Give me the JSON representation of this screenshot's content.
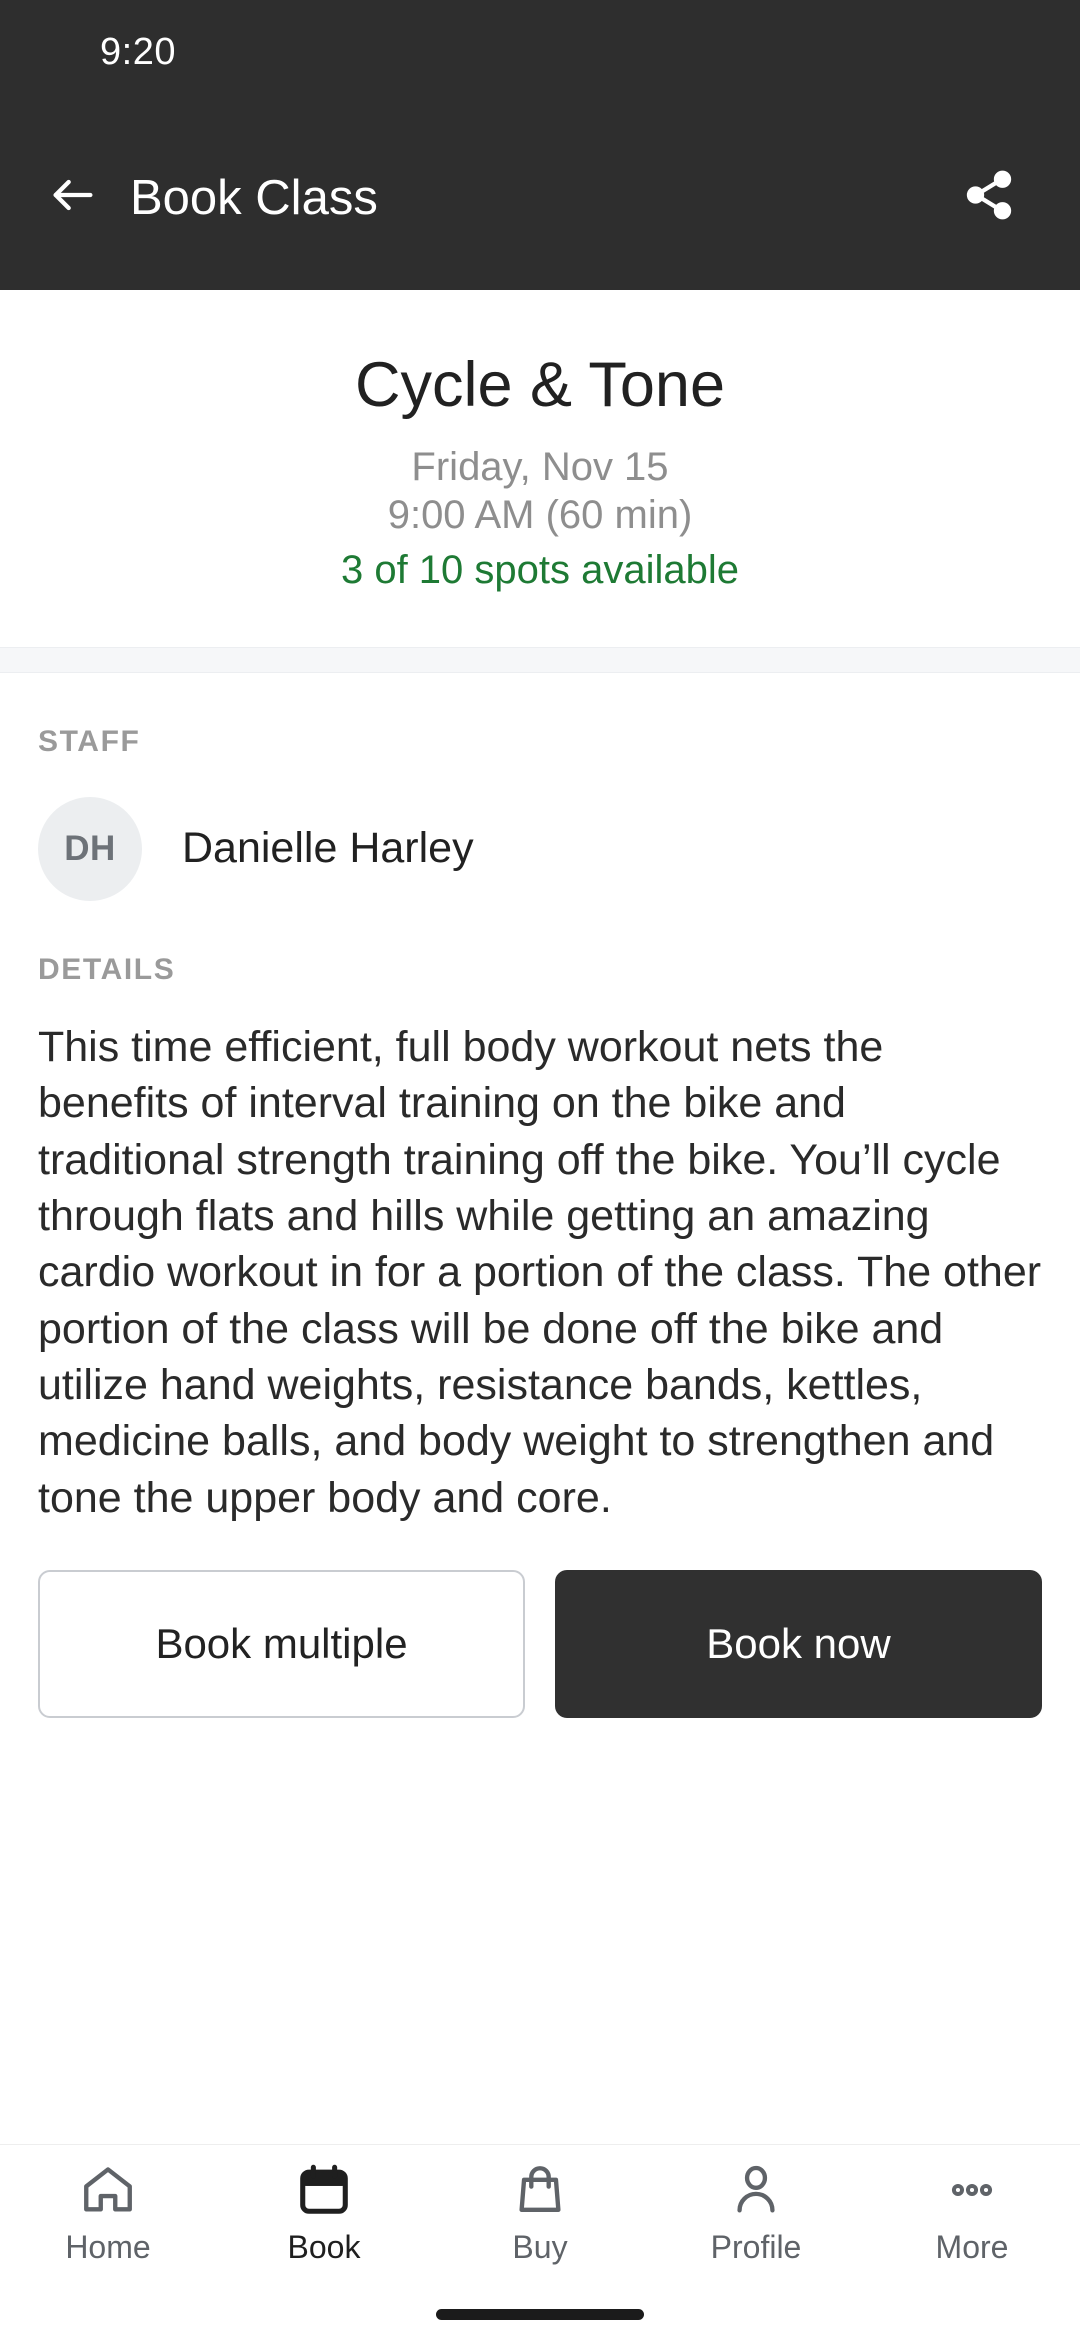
{
  "status_bar": {
    "time": "9:20"
  },
  "appbar": {
    "title": "Book Class",
    "back_icon": "arrow-left-icon",
    "share_icon": "share-icon"
  },
  "class": {
    "name": "Cycle & Tone",
    "date": "Friday, Nov 15",
    "time": "9:00 AM (60 min)",
    "spots": "3 of 10 spots available",
    "spots_color": "#1e7a34",
    "spots_open": 3,
    "spots_total": 10
  },
  "staff": {
    "label": "STAFF",
    "initials": "DH",
    "name": "Danielle Harley"
  },
  "details": {
    "label": "DETAILS",
    "text": "This time efficient, full body workout nets the benefits of interval training on the bike and traditional strength training off the bike. You’ll cycle through flats and hills while getting an amazing cardio workout in for a portion of the class. The other portion of the class will be done off the bike and utilize hand weights, resistance bands, kettles, medicine balls, and body weight to strengthen and tone the upper body and core."
  },
  "actions": {
    "secondary_label": "Book multiple",
    "primary_label": "Book now",
    "primary_color": "#303030"
  },
  "bottom_nav": {
    "items": [
      {
        "label": "Home",
        "icon": "home-icon",
        "active": false
      },
      {
        "label": "Book",
        "icon": "calendar-icon",
        "active": true
      },
      {
        "label": "Buy",
        "icon": "shopping-bag-icon",
        "active": false
      },
      {
        "label": "Profile",
        "icon": "person-icon",
        "active": false
      },
      {
        "label": "More",
        "icon": "more-dots-icon",
        "active": false
      }
    ]
  }
}
